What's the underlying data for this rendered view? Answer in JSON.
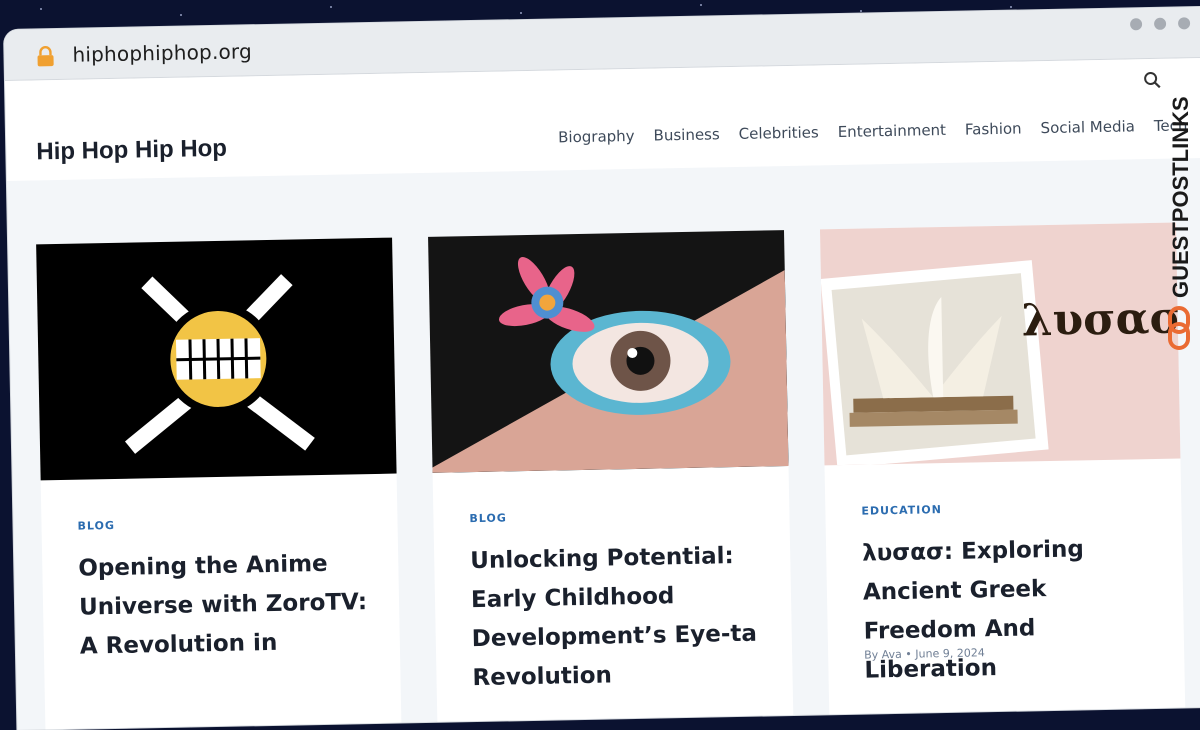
{
  "browser": {
    "url": "hiphophiphop.org"
  },
  "site": {
    "title": "Hip Hop Hip Hop",
    "nav": [
      "Biography",
      "Business",
      "Celebrities",
      "Entertainment",
      "Fashion",
      "Social Media",
      "Tech"
    ]
  },
  "cards": [
    {
      "category": "BLOG",
      "title": "Opening the Anime Universe with ZoroTV: A Revolution in"
    },
    {
      "category": "BLOG",
      "title": "Unlocking Potential: Early Childhood Development’s Eye-ta Revolution"
    },
    {
      "category": "EDUCATION",
      "title": "λυσασ: Exploring Ancient Greek Freedom And Liberation",
      "image_text": "λυσασ",
      "author": "By Ava",
      "date": "June 9, 2024"
    }
  ],
  "watermark": {
    "text": "GUESTPOSTLINKS"
  },
  "colors": {
    "accent": "#2b6cb0",
    "lock": "#f0a030",
    "watermark": "#ea6b33"
  }
}
